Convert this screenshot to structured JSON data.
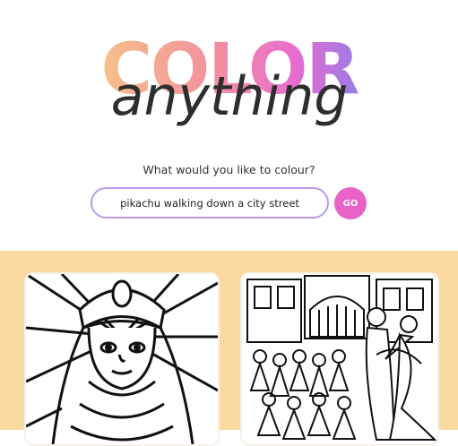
{
  "logo": {
    "word1": "COLOR",
    "word2": "anything"
  },
  "prompt_label": "What would you like to colour?",
  "search": {
    "value": "pikachu walking down a city street",
    "button_label": "GO"
  },
  "colors": {
    "accent_pink": "#e763c8",
    "input_border": "#b89be8",
    "gallery_bg": "#fbd9a0"
  },
  "gallery": [
    {
      "alt": "coloring page - pharaoh boy"
    },
    {
      "alt": "coloring page - dancing couple in town square"
    }
  ]
}
